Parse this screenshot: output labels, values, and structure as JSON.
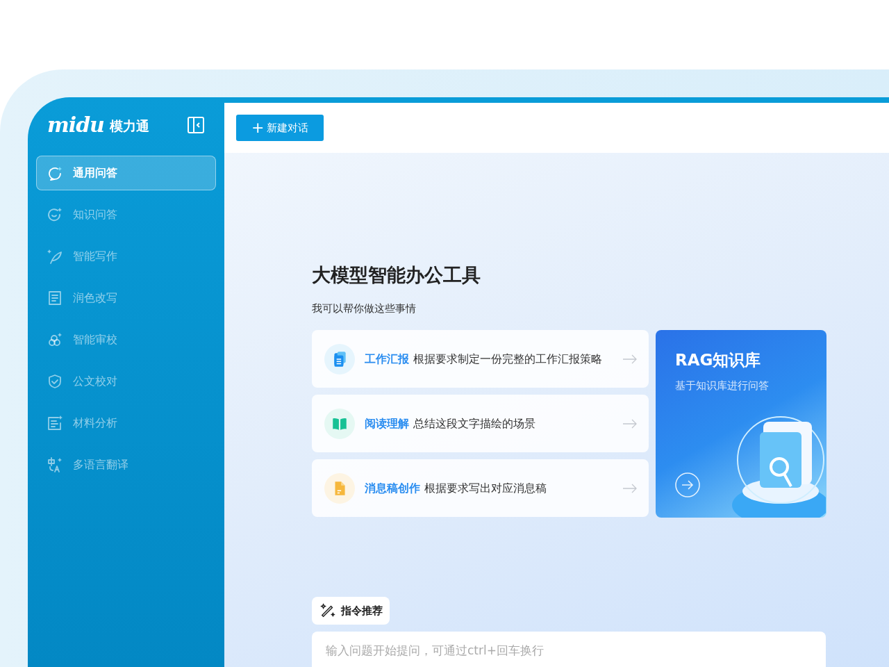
{
  "logo": {
    "wordmark": "midu",
    "name": "模力通"
  },
  "sidebar": {
    "items": [
      {
        "label": "通用问答",
        "selected": true
      },
      {
        "label": "知识问答",
        "selected": false
      },
      {
        "label": "智能写作",
        "selected": false
      },
      {
        "label": "润色改写",
        "selected": false
      },
      {
        "label": "智能审校",
        "selected": false
      },
      {
        "label": "公文校对",
        "selected": false
      },
      {
        "label": "材料分析",
        "selected": false
      },
      {
        "label": "多语言翻译",
        "selected": false
      }
    ]
  },
  "toolbar": {
    "new_chat_button": {
      "icon": "+",
      "label": "新建对话"
    }
  },
  "main": {
    "title": "大模型智能办公工具",
    "subtitle": "我可以帮你做这些事情",
    "suggestions": [
      {
        "title": "工作汇报",
        "description": "根据要求制定一份完整的工作汇报策略",
        "color": "#e6f5fd"
      },
      {
        "title": "阅读理解",
        "description": "总结这段文字描绘的场景",
        "color": "#e5f8f3"
      },
      {
        "title": "消息稿创作",
        "description": "根据要求写出对应消息稿",
        "color": "#fdf4e3"
      }
    ],
    "rag_card": {
      "title": "RAG知识库",
      "subtitle": "基于知识库进行问答"
    },
    "prompt_chip": "指令推荐",
    "input": {
      "placeholder": "输入问题开始提问，可通过ctrl+回车换行"
    }
  }
}
